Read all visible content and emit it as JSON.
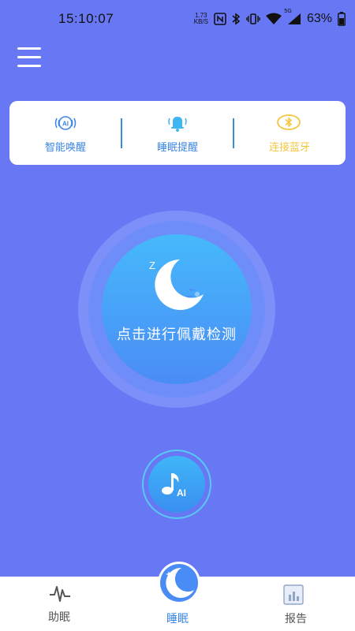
{
  "status_bar": {
    "time": "15:10:07",
    "net_speed_value": "1.73",
    "net_speed_unit": "KB/S",
    "network_type": "5G",
    "battery": "63%"
  },
  "feature_card": {
    "items": [
      {
        "label": "智能唤醒",
        "icon": "ai-wake-icon",
        "color": "#3a86e8"
      },
      {
        "label": "睡眠提醒",
        "icon": "bell-icon",
        "color": "#3a86e8"
      },
      {
        "label": "连接蓝牙",
        "icon": "bluetooth-icon",
        "color": "#f5c542"
      }
    ]
  },
  "detect": {
    "label": "点击进行佩戴检测",
    "icon": "sleeping-moon-icon"
  },
  "ai_music": {
    "icon_text": "AI"
  },
  "tab_bar": {
    "tabs": [
      {
        "label": "助眠",
        "icon": "waveform-icon"
      },
      {
        "label": "睡眠",
        "icon": "moon-stars-icon",
        "active": true
      },
      {
        "label": "报告",
        "icon": "report-chart-icon"
      }
    ]
  },
  "colors": {
    "background": "#6878f4",
    "accent_blue": "#3a86e8",
    "bluetooth_yellow": "#f5c542"
  }
}
